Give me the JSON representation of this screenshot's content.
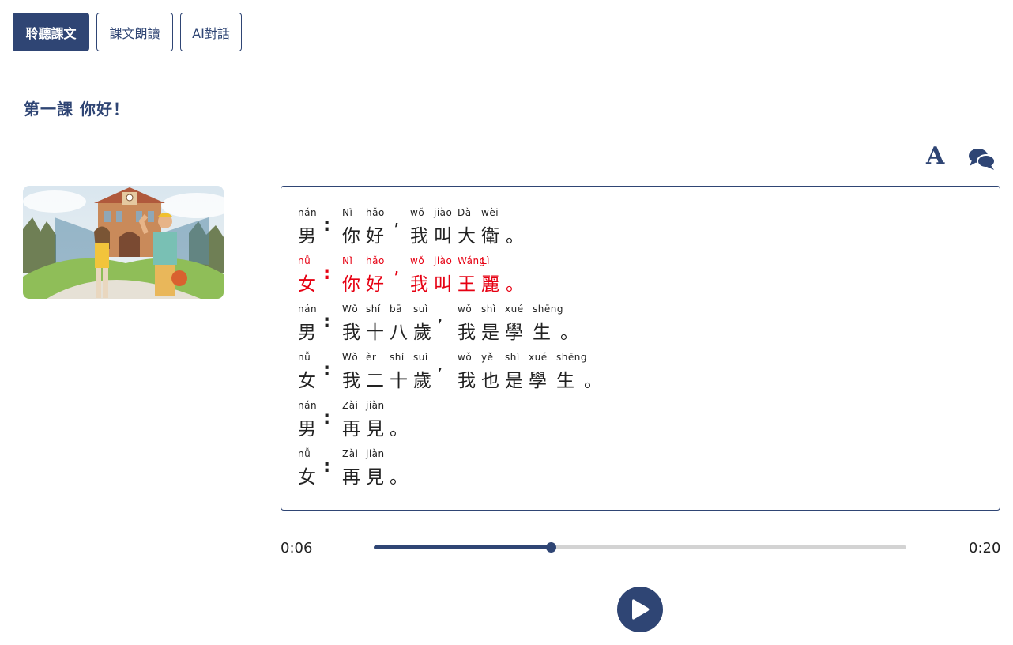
{
  "tabs": [
    {
      "label": "聆聽課文",
      "active": true
    },
    {
      "label": "課文朗讀",
      "active": false
    },
    {
      "label": "AI對話",
      "active": false
    }
  ],
  "lesson_title": "第一課 你好！",
  "toolbar": {
    "font_icon": "A",
    "font_icon_name": "font-size-icon",
    "chat_icon_name": "chat-bubbles-icon"
  },
  "dialogue": [
    {
      "speaker_py": "nán",
      "speaker": "男",
      "highlight": false,
      "parts": [
        {
          "py": "Nǐ",
          "hz": "你"
        },
        {
          "py": "hǎo",
          "hz": "好"
        },
        {
          "py": "",
          "hz": "’"
        },
        {
          "py": "wǒ",
          "hz": "我"
        },
        {
          "py": "jiào",
          "hz": "叫"
        },
        {
          "py": "Dà",
          "hz": "大"
        },
        {
          "py": "wèi",
          "hz": "衛"
        },
        {
          "py": "",
          "hz": "。"
        }
      ]
    },
    {
      "speaker_py": "nǚ",
      "speaker": "女",
      "highlight": true,
      "parts": [
        {
          "py": "Nǐ",
          "hz": "你"
        },
        {
          "py": "hǎo",
          "hz": "好"
        },
        {
          "py": "",
          "hz": "’"
        },
        {
          "py": "wǒ",
          "hz": "我"
        },
        {
          "py": "jiào",
          "hz": "叫"
        },
        {
          "py": "Wáng",
          "hz": "王"
        },
        {
          "py": "Lì",
          "hz": "麗"
        },
        {
          "py": "",
          "hz": "。"
        }
      ]
    },
    {
      "speaker_py": "nán",
      "speaker": "男",
      "highlight": false,
      "parts": [
        {
          "py": "Wǒ",
          "hz": "我"
        },
        {
          "py": "shí",
          "hz": "十"
        },
        {
          "py": "bā",
          "hz": "八"
        },
        {
          "py": "suì",
          "hz": "歲"
        },
        {
          "py": "",
          "hz": "’"
        },
        {
          "py": "wǒ",
          "hz": "我"
        },
        {
          "py": "shì",
          "hz": "是"
        },
        {
          "py": "xué",
          "hz": "學"
        },
        {
          "py": "shēng",
          "hz": "生"
        },
        {
          "py": "",
          "hz": "。"
        }
      ]
    },
    {
      "speaker_py": "nǚ",
      "speaker": "女",
      "highlight": false,
      "parts": [
        {
          "py": "Wǒ",
          "hz": "我"
        },
        {
          "py": "èr",
          "hz": "二"
        },
        {
          "py": "shí",
          "hz": "十"
        },
        {
          "py": "suì",
          "hz": "歲"
        },
        {
          "py": "",
          "hz": "’"
        },
        {
          "py": "wǒ",
          "hz": "我"
        },
        {
          "py": "yě",
          "hz": "也"
        },
        {
          "py": "shì",
          "hz": "是"
        },
        {
          "py": "xué",
          "hz": "學"
        },
        {
          "py": "shēng",
          "hz": "生"
        },
        {
          "py": "",
          "hz": "。"
        }
      ]
    },
    {
      "speaker_py": "nán",
      "speaker": "男",
      "highlight": false,
      "parts": [
        {
          "py": "Zài",
          "hz": "再"
        },
        {
          "py": "jiàn",
          "hz": "見"
        },
        {
          "py": "",
          "hz": "。"
        }
      ]
    },
    {
      "speaker_py": "nǚ",
      "speaker": "女",
      "highlight": false,
      "parts": [
        {
          "py": "Zài",
          "hz": "再"
        },
        {
          "py": "jiàn",
          "hz": "見"
        },
        {
          "py": "",
          "hz": "。"
        }
      ]
    }
  ],
  "player": {
    "current": "0:06",
    "total": "0:20",
    "progress": 0.333,
    "play_icon_name": "play-icon"
  },
  "colors": {
    "accent": "#2f4574",
    "highlight": "#e60012",
    "track": "#d3d3d3"
  }
}
